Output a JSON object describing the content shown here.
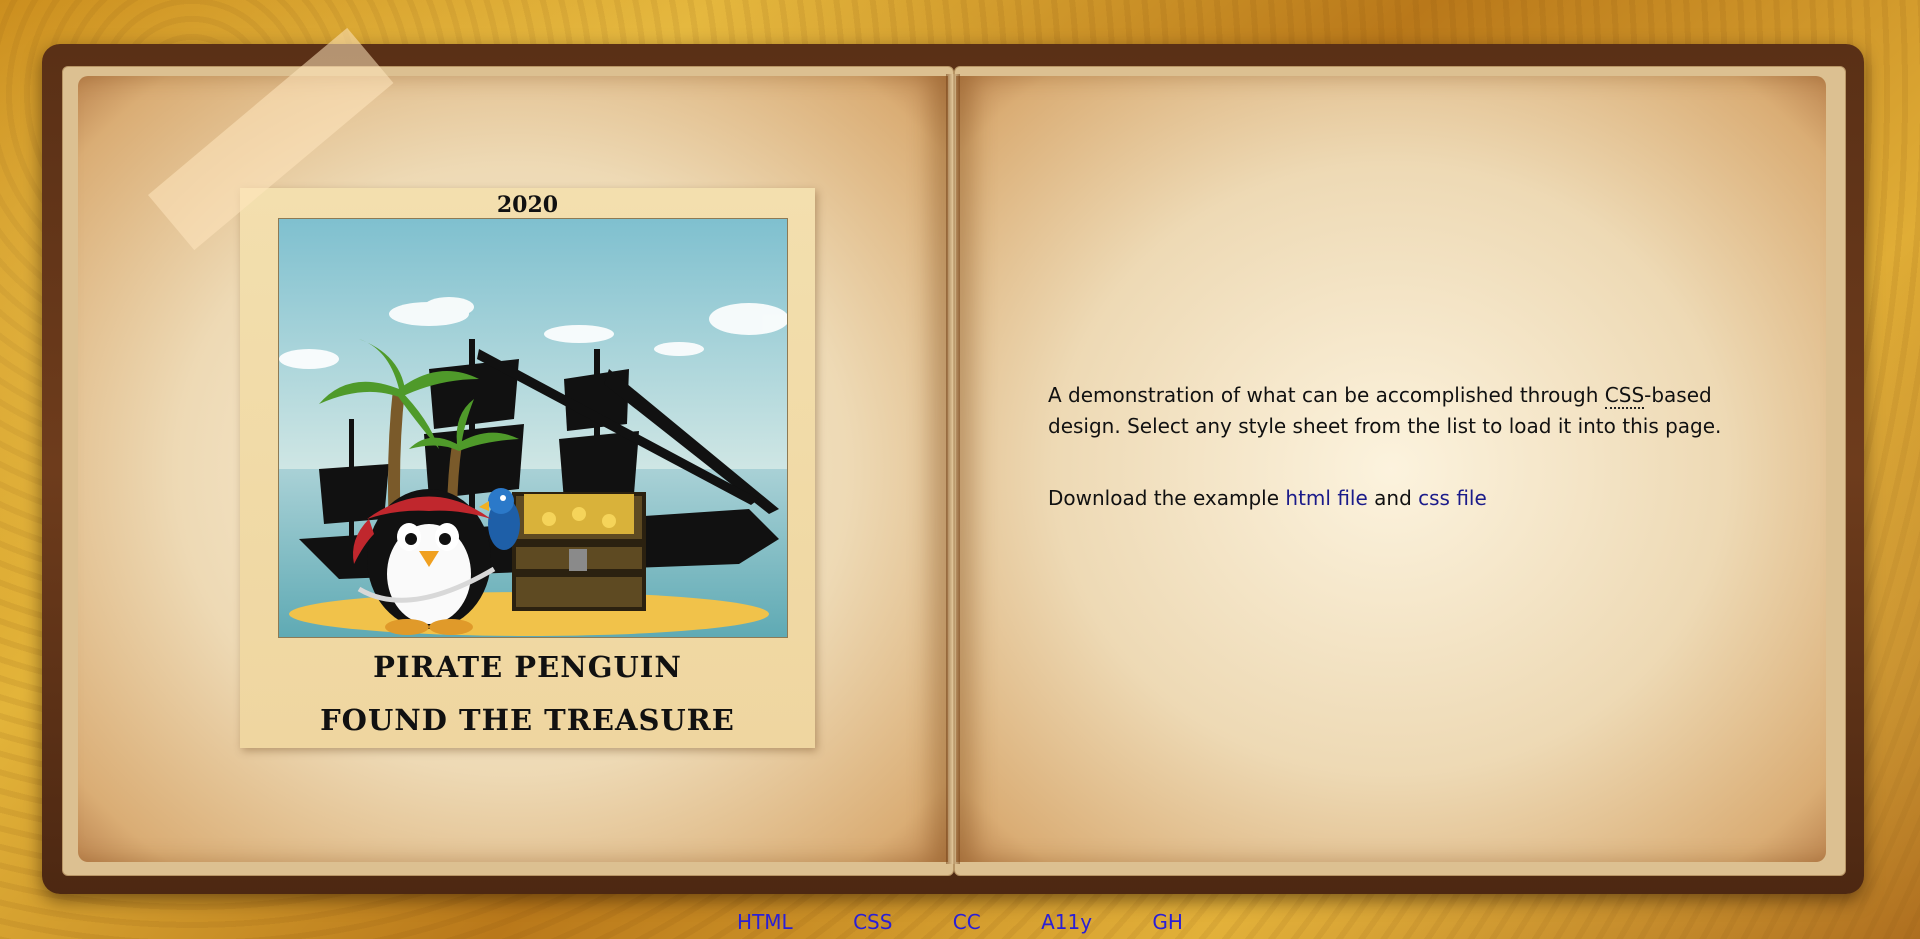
{
  "polaroid": {
    "year": "2020",
    "caption_line1": "PIRATE PENGUIN",
    "caption_line2": "FOUND THE TREASURE"
  },
  "intro": {
    "before_abbr": "A demonstration of what can be accomplished through ",
    "abbr": "CSS",
    "after_abbr": "-based design. Select any style sheet from the list to load it into this page."
  },
  "download": {
    "prefix": "Download the example ",
    "html_link": "html file",
    "middle": " and ",
    "css_link": "css file"
  },
  "footer_nav": [
    "HTML",
    "CSS",
    "CC",
    "A11y",
    "GH"
  ],
  "colors": {
    "link": "#1b1b8a",
    "footer_link": "#2a1fd6",
    "page": "#ead5ad",
    "cover": "#5a3016"
  }
}
